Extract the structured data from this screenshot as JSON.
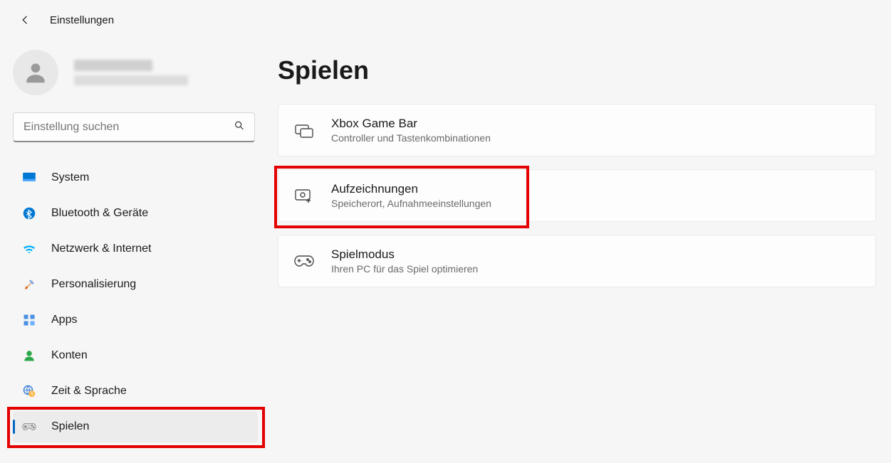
{
  "header": {
    "app_title": "Einstellungen"
  },
  "search": {
    "placeholder": "Einstellung suchen"
  },
  "nav": {
    "items": [
      {
        "label": "System",
        "icon": "monitor-icon"
      },
      {
        "label": "Bluetooth & Geräte",
        "icon": "bluetooth-icon"
      },
      {
        "label": "Netzwerk & Internet",
        "icon": "wifi-icon"
      },
      {
        "label": "Personalisierung",
        "icon": "brush-icon"
      },
      {
        "label": "Apps",
        "icon": "apps-icon"
      },
      {
        "label": "Konten",
        "icon": "user-icon"
      },
      {
        "label": "Zeit & Sprache",
        "icon": "globe-clock-icon"
      },
      {
        "label": "Spielen",
        "icon": "gamepad-icon"
      }
    ],
    "active_index": 7
  },
  "page": {
    "title": "Spielen",
    "cards": [
      {
        "title": "Xbox Game Bar",
        "sub": "Controller und Tastenkombinationen"
      },
      {
        "title": "Aufzeichnungen",
        "sub": "Speicherort, Aufnahmeeinstellungen"
      },
      {
        "title": "Spielmodus",
        "sub": "Ihren PC für das Spiel optimieren"
      }
    ],
    "highlight_card_index": 1
  }
}
